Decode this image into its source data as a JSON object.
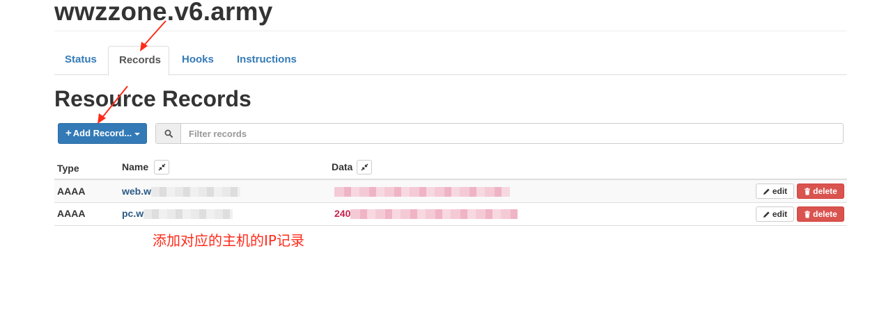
{
  "zone": {
    "title": "wwzzone.v6.army"
  },
  "tabs": [
    {
      "label": "Status",
      "active": false
    },
    {
      "label": "Records",
      "active": true
    },
    {
      "label": "Hooks",
      "active": false
    },
    {
      "label": "Instructions",
      "active": false
    }
  ],
  "section": {
    "title": "Resource Records"
  },
  "toolbar": {
    "add_label": "Add Record...",
    "filter_placeholder": "Filter records"
  },
  "table": {
    "columns": [
      "Type",
      "Name",
      "Data"
    ],
    "rows": [
      {
        "type": "AAAA",
        "name_prefix": "web.w",
        "data_prefix": "",
        "edit": "edit",
        "delete": "delete"
      },
      {
        "type": "AAAA",
        "name_prefix": "pc.w",
        "data_prefix": "240",
        "edit": "edit",
        "delete": "delete"
      }
    ]
  },
  "annotation": {
    "text": "添加对应的主机的IP记录"
  },
  "colors": {
    "primary": "#337ab7",
    "danger": "#d9534f",
    "annotation": "#ff2a1a",
    "code": "#c7254e"
  },
  "icons": [
    "search-icon",
    "plus-icon",
    "caret-down-icon",
    "compress-icon",
    "pencil-icon",
    "trash-icon",
    "red-arrow-annotation"
  ]
}
